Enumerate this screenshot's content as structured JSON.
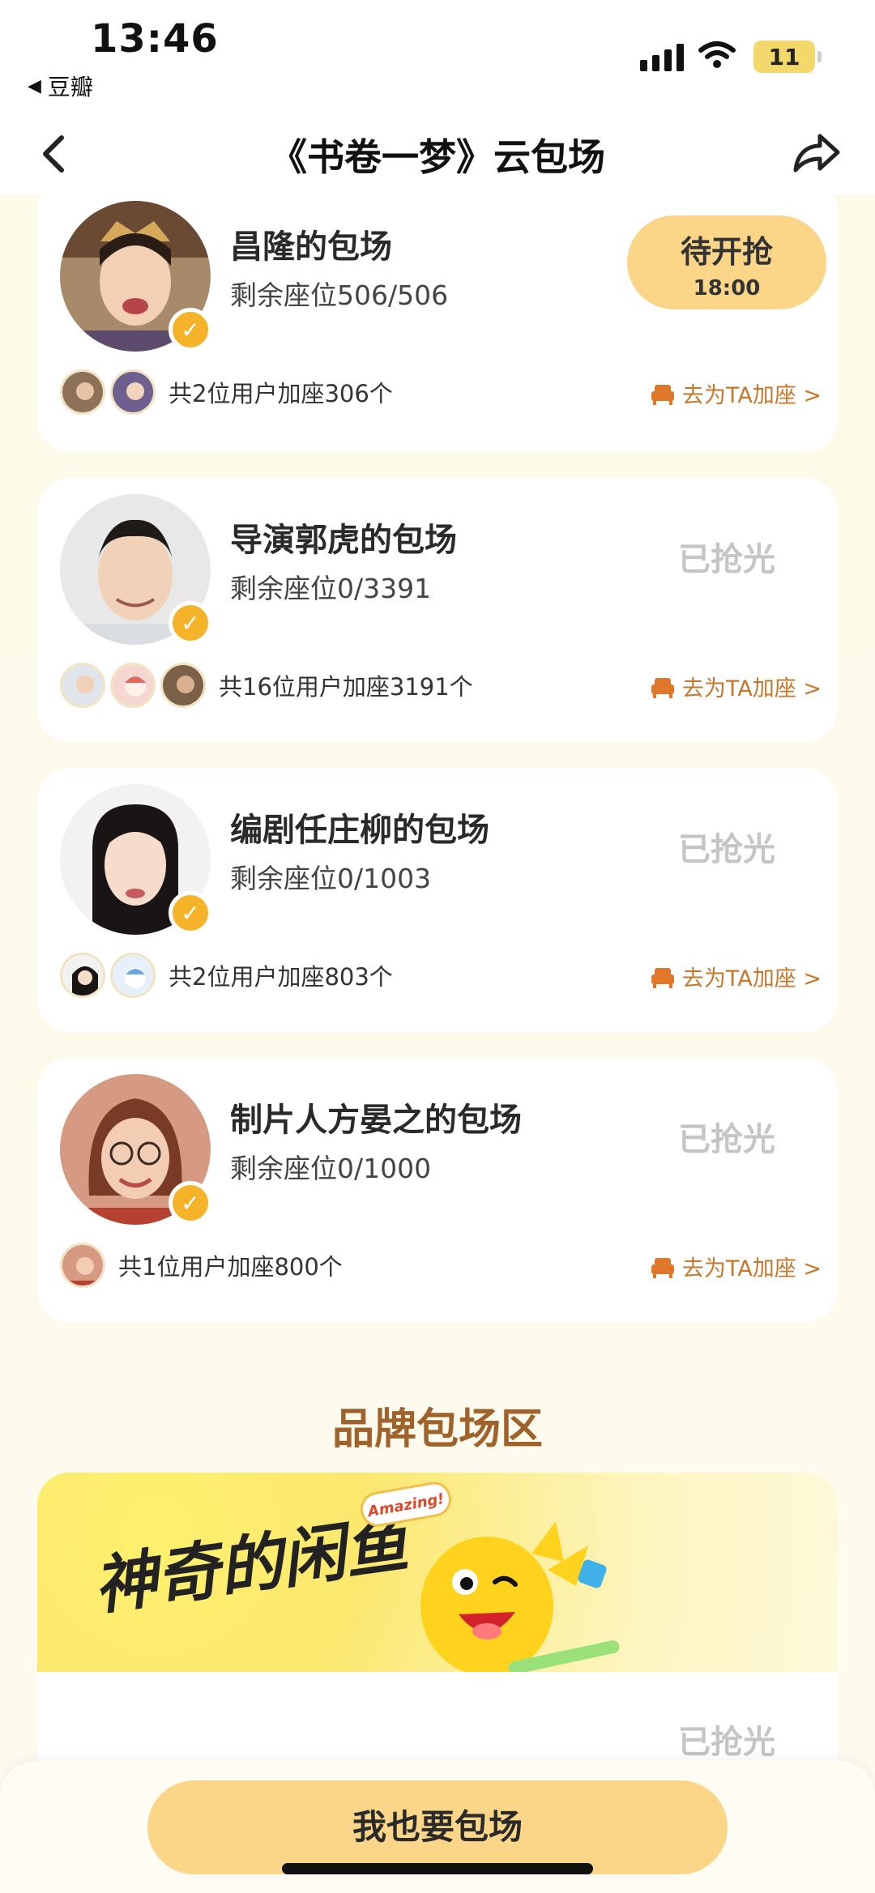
{
  "status_bar": {
    "time": "13:46",
    "back_app": "豆瓣",
    "battery": "11"
  },
  "nav": {
    "title": "《书卷一梦》云包场"
  },
  "cards": [
    {
      "name": "昌隆的包场",
      "seats": "剩余座位506/506",
      "status": "待开抢",
      "status_time": "18:00",
      "footer": "共2位用户加座306个",
      "join": "去为TA加座 >"
    },
    {
      "name": "导演郭虎的包场",
      "seats": "剩余座位0/3391",
      "status": "已抢光",
      "footer": "共16位用户加座3191个",
      "join": "去为TA加座 >"
    },
    {
      "name": "编剧任庄柳的包场",
      "seats": "剩余座位0/1003",
      "status": "已抢光",
      "footer": "共2位用户加座803个",
      "join": "去为TA加座 >"
    },
    {
      "name": "制片人方晏之的包场",
      "seats": "剩余座位0/1000",
      "status": "已抢光",
      "footer": "共1位用户加座800个",
      "join": "去为TA加座 >"
    }
  ],
  "brand_section": {
    "title": "品牌包场区",
    "banner_text": "神奇的闲鱼",
    "sticker_text": "Amazing!",
    "status": "已抢光"
  },
  "cta": {
    "label": "我也要包场"
  },
  "colors": {
    "accent": "#fbd588",
    "brand_title": "#a0622b",
    "link": "#c5772b",
    "sold_out": "#c5c5c5"
  }
}
